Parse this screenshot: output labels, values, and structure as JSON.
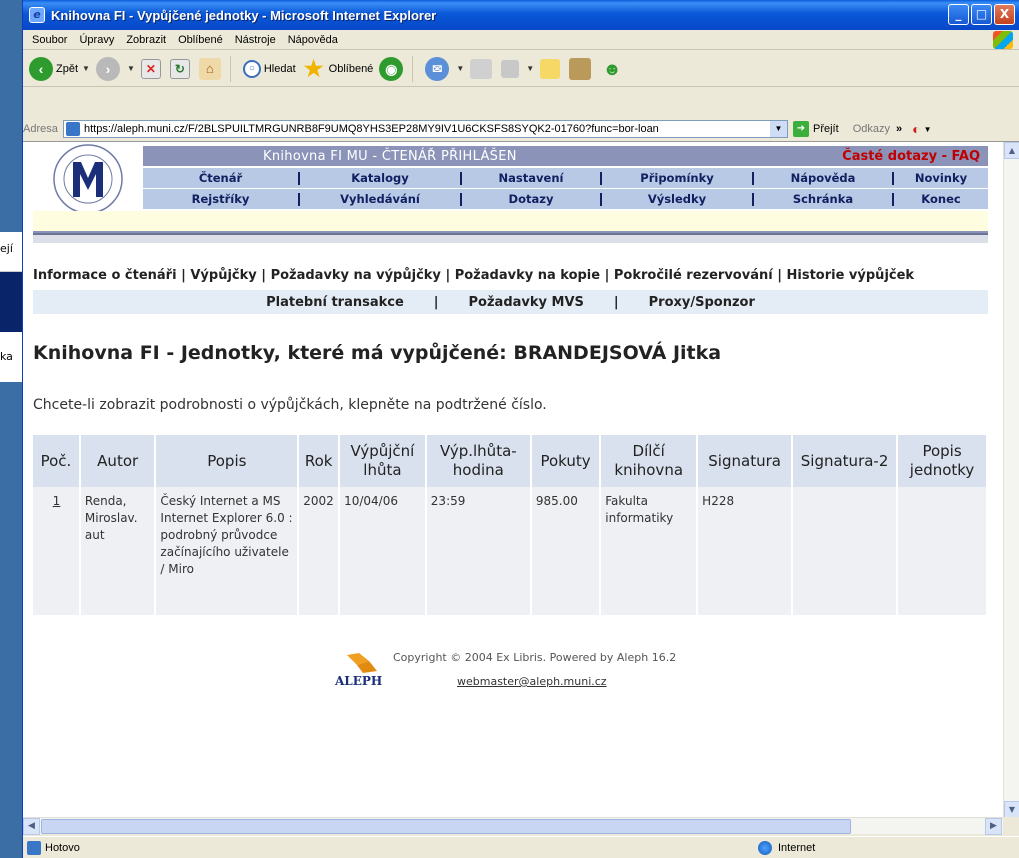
{
  "window": {
    "title": "Knihovna FI - Vypůjčené jednotky - Microsoft Internet Explorer",
    "controls": {
      "minimize": "_",
      "maximize": "□",
      "close": "X"
    }
  },
  "background_peeks": {
    "a": "ejí",
    "b": "ka"
  },
  "menu": [
    "Soubor",
    "Úpravy",
    "Zobrazit",
    "Oblíbené",
    "Nástroje",
    "Nápověda"
  ],
  "toolbar": {
    "back": "Zpět",
    "search": "Hledat",
    "favorites": "Oblíbené"
  },
  "address": {
    "label": "Adresa",
    "value": "https://aleph.muni.cz/F/2BLSPUILTMRGUNRB8F9UMQ8YHS3EP28MY9IV1U6CKSFS8SYQK2-01760?func=bor-loan",
    "go": "Přejít",
    "links": "Odkazy"
  },
  "header": {
    "title": "Knihovna FI MU - ČTENÁŘ PŘIHLÁŠEN",
    "faq": "Časté dotazy - FAQ",
    "nav1": [
      "Čtenář",
      "Katalogy",
      "Nastavení",
      "Připomínky",
      "Nápověda",
      "Novinky"
    ],
    "nav2": [
      "Rejstříky",
      "Vyhledávání",
      "Dotazy",
      "Výsledky",
      "Schránka",
      "Konec"
    ]
  },
  "subnav": {
    "row1": [
      "Informace o čtenáři",
      "Výpůjčky",
      "Požadavky na výpůjčky",
      "Požadavky na kopie",
      "Pokročilé rezervování",
      "Historie výpůjček"
    ],
    "row2": [
      "Platební transakce",
      "Požadavky MVS",
      "Proxy/Sponzor"
    ]
  },
  "page_title": "Knihovna FI - Jednotky, které má vypůjčené: BRANDEJSOVÁ Jitka",
  "intro": "Chcete-li zobrazit podrobnosti o výpůjčkách, klepněte na podtržené číslo.",
  "table": {
    "headers": [
      "Poč.",
      "Autor",
      "Popis",
      "Rok",
      "Výpůjční lhůta",
      "Výp.lhůta-hodina",
      "Pokuty",
      "Dílčí knihovna",
      "Signatura",
      "Signatura-2",
      "Popis jednotky"
    ],
    "rows": [
      {
        "num": "1",
        "autor": "Renda, Miroslav. aut",
        "popis": "Český Internet a MS Internet Explorer 6.0 : podrobný průvodce začínajícího uživatele / Miro",
        "rok": "2002",
        "lhuta": "10/04/06",
        "hodina": "23:59",
        "pokuty": "985.00",
        "knihovna": "Fakulta informatiky",
        "signatura": "H228",
        "signatura2": "",
        "popis_jednotky": ""
      }
    ]
  },
  "footer": {
    "copyright": "Copyright © 2004 Ex Libris. Powered by Aleph 16.2",
    "email": "webmaster@aleph.muni.cz",
    "logo_text": "ALEPH"
  },
  "status": {
    "left": "Hotovo",
    "zone": "Internet"
  },
  "colors": {
    "title_bar": "#0a58d8",
    "header_bar": "#8b94b8",
    "nav_bar": "#b8c9e6",
    "faq": "#c00000",
    "table_header": "#d9e1ee"
  }
}
